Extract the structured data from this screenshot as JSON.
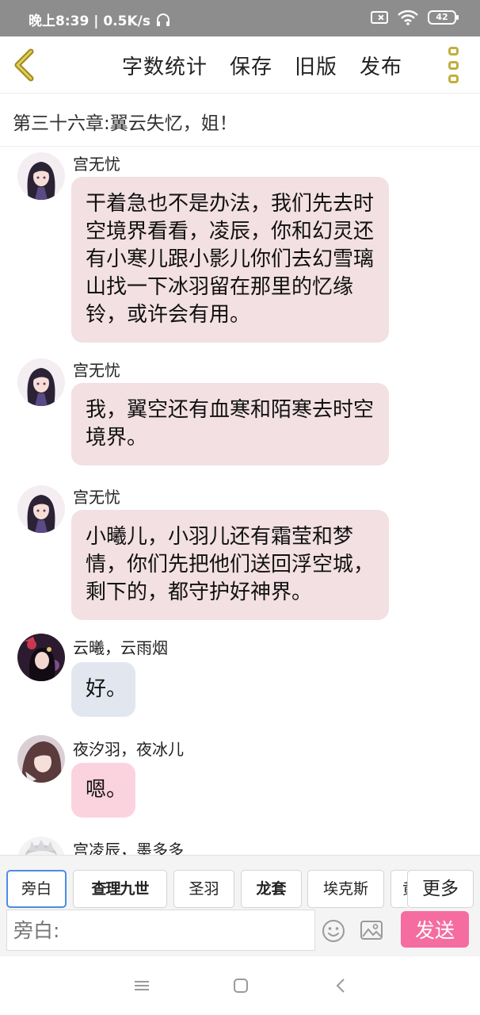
{
  "status_bar": {
    "time_speed": "晚上8:39 | 0.5K/s",
    "battery": "42",
    "icons": [
      "headphones-icon",
      "sim-disabled-icon",
      "wifi-icon",
      "battery-icon"
    ]
  },
  "toolbar": {
    "word_count": "字数统计",
    "save": "保存",
    "old_version": "旧版",
    "publish": "发布",
    "back_icon": "chevron-left-icon",
    "menu_icon": "more-vertical-icon",
    "accent_color": "#c2ae3d"
  },
  "chapter": {
    "title": "第三十六章:翼云失忆，姐！"
  },
  "messages": [
    {
      "sender": "宫无忧",
      "text": "干着急也不是办法，我们先去时空境界看看，凌辰，你和幻灵还有小寒儿跟小影儿你们去幻雪璃山找一下冰羽留在那里的忆缘铃，或许会有用。"
    },
    {
      "sender": "宫无忧",
      "text": "我，翼空还有血寒和陌寒去时空境界。"
    },
    {
      "sender": "宫无忧",
      "text": "小曦儿，小羽儿还有霜莹和梦情，你们先把他们送回浮空城，剩下的，都守护好神界。"
    },
    {
      "sender": "云曦，云雨烟",
      "text": "好。"
    },
    {
      "sender": "夜汐羽，夜冰儿",
      "text": "嗯。"
    },
    {
      "sender": "宫凌辰，墨多多",
      "text": ""
    }
  ],
  "characters": {
    "chips": [
      "旁白",
      "查理九世",
      "圣羽",
      "龙套",
      "埃克斯",
      "黄"
    ],
    "selected": "旁白",
    "more": "更多"
  },
  "composer": {
    "placeholder": "旁白:",
    "send": "发送",
    "send_color": "#f56da0"
  },
  "nav_bar": {
    "icons": [
      "menu-icon",
      "home-square-icon",
      "back-chevron-icon"
    ]
  }
}
